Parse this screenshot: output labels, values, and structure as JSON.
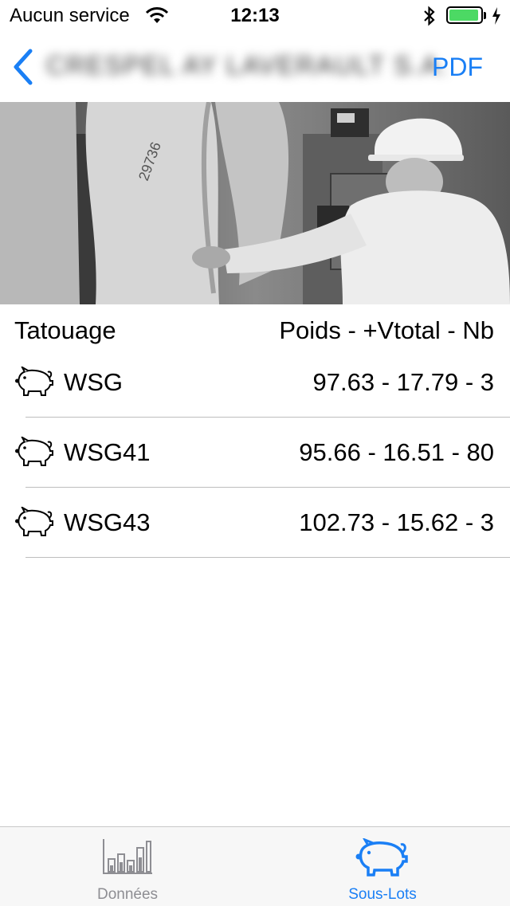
{
  "status": {
    "carrier": "Aucun service",
    "time": "12:13",
    "battery_level": 0.95,
    "battery_color": "#4cd964"
  },
  "nav": {
    "back_icon": "chevron-left-icon",
    "title": "CRESPEL AY LAVERAULT S.A.",
    "pdf_label": "PDF",
    "accent": "#1a7ff5"
  },
  "hero": {
    "icon": "slaughterhouse-photo"
  },
  "list": {
    "header_left": "Tatouage",
    "header_right": "Poids - +Vtotal - Nb",
    "rows": [
      {
        "name": "WSG",
        "value": "97.63 - 17.79 - 3",
        "icon": "pig-icon"
      },
      {
        "name": "WSG41",
        "value": "95.66 - 16.51 - 80",
        "icon": "pig-icon"
      },
      {
        "name": "WSG43",
        "value": "102.73 - 15.62 - 3",
        "icon": "pig-icon"
      }
    ]
  },
  "tabbar": {
    "tabs": [
      {
        "label": "Données",
        "icon": "bar-chart-icon",
        "active": false,
        "color": "#8e8e93"
      },
      {
        "label": "Sous-Lots",
        "icon": "pig-icon",
        "active": true,
        "color": "#1a7ff5"
      }
    ]
  }
}
